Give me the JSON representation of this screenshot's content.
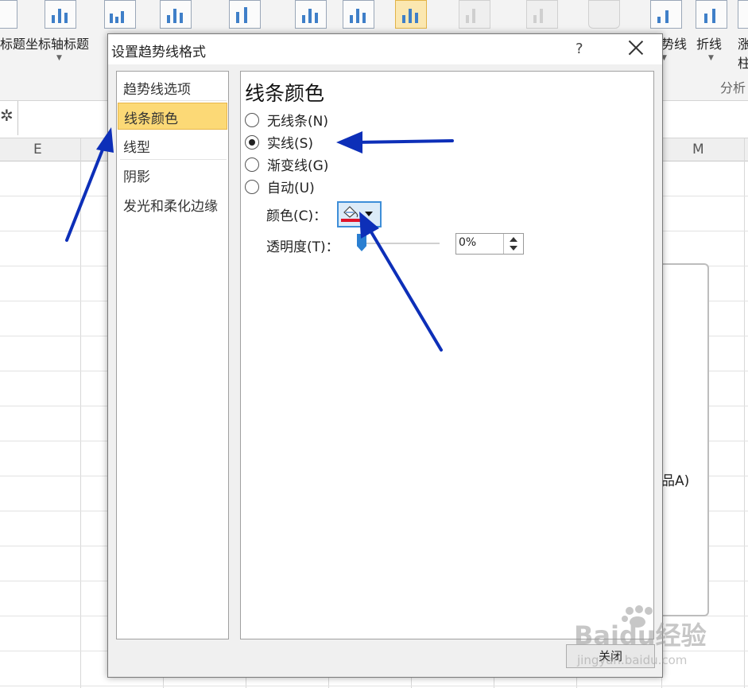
{
  "ribbon": {
    "labels": {
      "chart_title_partial": "标题",
      "axis_title": "坐标轴标题",
      "trendline_partial": "势线",
      "line": "折线",
      "col_partial_top": "涨",
      "col_partial_bottom": "柱"
    },
    "group_label_partial": "分析"
  },
  "sheet": {
    "columns": [
      "E",
      "M"
    ],
    "chart_text_partial": "品A)"
  },
  "dialog": {
    "title": "设置趋势线格式",
    "help_symbol": "?",
    "nav": [
      {
        "label": "趋势线选项"
      },
      {
        "label": "线条颜色"
      },
      {
        "label": "线型"
      },
      {
        "label": "阴影"
      },
      {
        "label": "发光和柔化边缘"
      }
    ],
    "selected_nav": "线条颜色",
    "section_heading": "线条颜色",
    "options": [
      {
        "label": "无线条(N)",
        "selected": false
      },
      {
        "label": "实线(S)",
        "selected": true
      },
      {
        "label": "渐变线(G)",
        "selected": false
      },
      {
        "label": "自动(U)",
        "selected": false
      }
    ],
    "color_label": "颜色(C)：",
    "color_value": "#e0142a",
    "transparency_label": "透明度(T)：",
    "transparency_value": "0%",
    "transparency_level": 0,
    "close_label": "关闭"
  },
  "watermark": {
    "brand": "Baidu经验",
    "url": "jingyan.baidu.com"
  },
  "accent_colors": {
    "arrow": "#0d2fb8",
    "selection": "#fcd976",
    "focus": "#3e8ed8"
  }
}
